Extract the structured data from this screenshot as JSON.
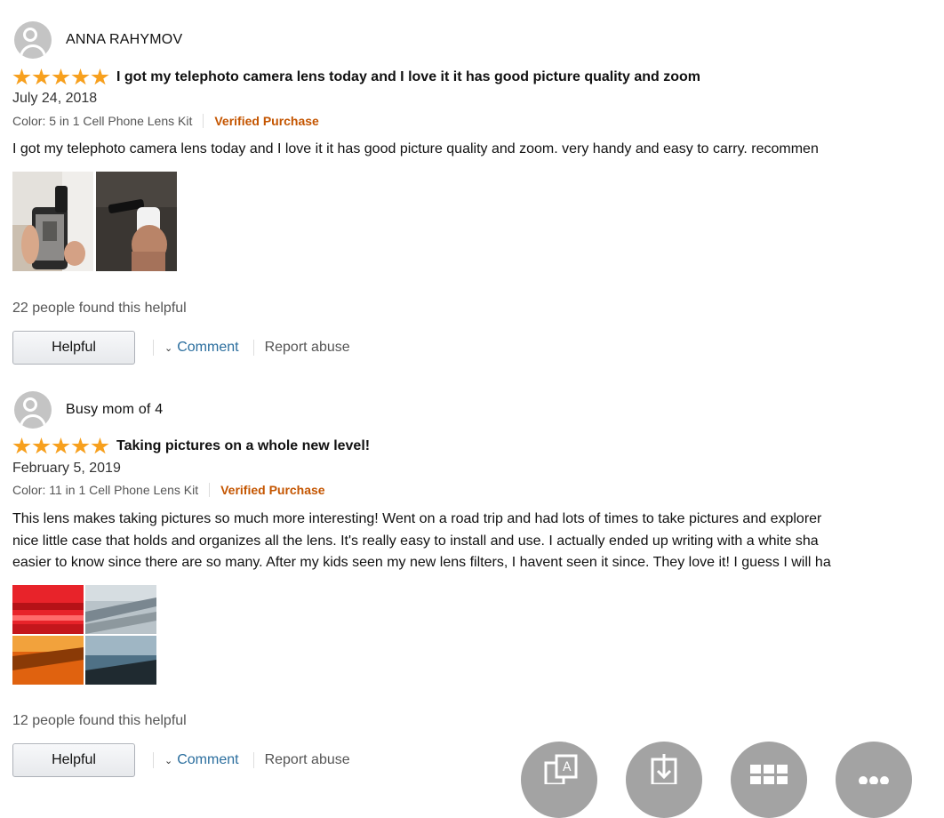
{
  "reviews": [
    {
      "reviewer": "ANNA RAHYMOV",
      "rating": 5,
      "title": "I got my telephoto camera lens today and I love it it has good picture quality and zoom",
      "date": "July 24, 2018",
      "color_option": "Color: 5 in 1 Cell Phone Lens Kit",
      "verified": "Verified Purchase",
      "body_lines": [
        "I got my telephoto camera lens today and I love it it has good picture quality and zoom. very handy and easy to carry. recommen"
      ],
      "helpful_count": "22 people found this helpful",
      "helpful_label": "Helpful",
      "comment_label": "Comment",
      "report_label": "Report abuse"
    },
    {
      "reviewer": "Busy mom of 4",
      "rating": 5,
      "title": "Taking pictures on a whole new level!",
      "date": "February 5, 2019",
      "color_option": "Color: 11 in 1 Cell Phone Lens Kit",
      "verified": "Verified Purchase",
      "body_lines": [
        "This lens makes taking pictures so much more interesting! Went on a road trip and had lots of times to take pictures and explorer",
        "nice little case that holds and organizes all the lens. It's really easy to install and use. I actually ended up writing with a white sha",
        "easier to know since there are so many. After my kids seen my new lens filters, I havent seen it since. They love it! I guess I will ha"
      ],
      "helpful_count": "12 people found this helpful",
      "helpful_label": "Helpful",
      "comment_label": "Comment",
      "report_label": "Report abuse"
    }
  ],
  "colors": {
    "star": "#f7a01e",
    "verified": "#c45500",
    "link": "#2b6e9e",
    "fab": "#a3a3a3"
  },
  "floating_toolbar": [
    "translate-icon",
    "download-icon",
    "grid-icon",
    "more-icon"
  ]
}
